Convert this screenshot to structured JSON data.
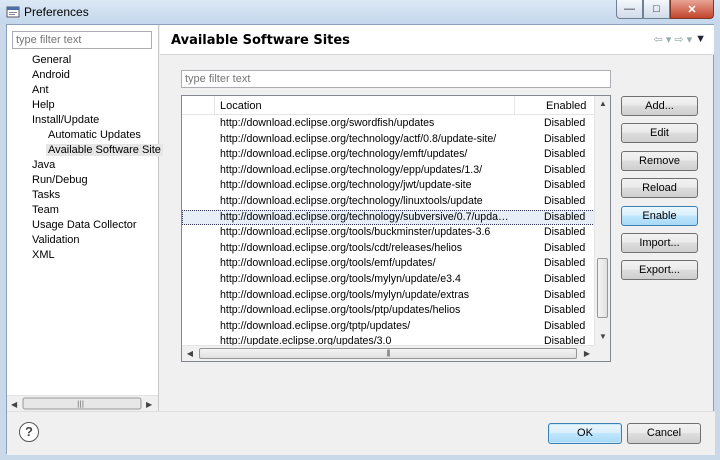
{
  "window": {
    "title": "Preferences",
    "controls": [
      "minimize",
      "maximize",
      "close"
    ]
  },
  "left": {
    "filter_placeholder": "type filter text",
    "tree": [
      {
        "label": "General",
        "level": 0
      },
      {
        "label": "Android",
        "level": 0
      },
      {
        "label": "Ant",
        "level": 0
      },
      {
        "label": "Help",
        "level": 0
      },
      {
        "label": "Install/Update",
        "level": 0
      },
      {
        "label": "Automatic Updates",
        "level": 1
      },
      {
        "label": "Available Software Site",
        "level": 1,
        "selected": true
      },
      {
        "label": "Java",
        "level": 0
      },
      {
        "label": "Run/Debug",
        "level": 0
      },
      {
        "label": "Tasks",
        "level": 0
      },
      {
        "label": "Team",
        "level": 0
      },
      {
        "label": "Usage Data Collector",
        "level": 0
      },
      {
        "label": "Validation",
        "level": 0
      },
      {
        "label": "XML",
        "level": 0
      }
    ]
  },
  "page": {
    "title": "Available Software Sites",
    "filter_placeholder": "type filter text",
    "columns": {
      "location": "Location",
      "enabled": "Enabled"
    },
    "rows": [
      {
        "location": "http://download.eclipse.org/swordfish/updates",
        "enabled": "Disabled"
      },
      {
        "location": "http://download.eclipse.org/technology/actf/0.8/update-site/",
        "enabled": "Disabled"
      },
      {
        "location": "http://download.eclipse.org/technology/emft/updates/",
        "enabled": "Disabled"
      },
      {
        "location": "http://download.eclipse.org/technology/epp/updates/1.3/",
        "enabled": "Disabled"
      },
      {
        "location": "http://download.eclipse.org/technology/jwt/update-site",
        "enabled": "Disabled"
      },
      {
        "location": "http://download.eclipse.org/technology/linuxtools/update",
        "enabled": "Disabled"
      },
      {
        "location": "http://download.eclipse.org/technology/subversive/0.7/update...",
        "enabled": "Disabled",
        "selected": true
      },
      {
        "location": "http://download.eclipse.org/tools/buckminster/updates-3.6",
        "enabled": "Disabled"
      },
      {
        "location": "http://download.eclipse.org/tools/cdt/releases/helios",
        "enabled": "Disabled"
      },
      {
        "location": "http://download.eclipse.org/tools/emf/updates/",
        "enabled": "Disabled"
      },
      {
        "location": "http://download.eclipse.org/tools/mylyn/update/e3.4",
        "enabled": "Disabled"
      },
      {
        "location": "http://download.eclipse.org/tools/mylyn/update/extras",
        "enabled": "Disabled"
      },
      {
        "location": "http://download.eclipse.org/tools/ptp/updates/helios",
        "enabled": "Disabled"
      },
      {
        "location": "http://download.eclipse.org/tptp/updates/",
        "enabled": "Disabled"
      },
      {
        "location": "http://update.eclipse.org/updates/3.0",
        "enabled": "Disabled"
      }
    ],
    "buttons": {
      "add": "Add...",
      "edit": "Edit",
      "remove": "Remove",
      "reload": "Reload",
      "enable": "Enable",
      "import": "Import...",
      "export": "Export..."
    }
  },
  "footer": {
    "help_glyph": "?",
    "ok": "OK",
    "cancel": "Cancel"
  }
}
